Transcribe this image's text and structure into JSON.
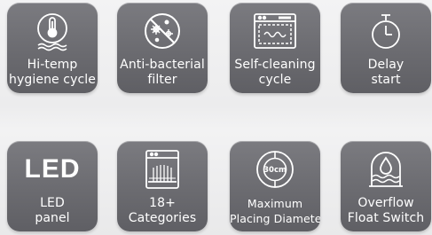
{
  "features": [
    {
      "id": "hitemp",
      "icon": "thermometer-hygiene-icon",
      "lines": [
        "Hi-temp",
        "hygiene cycle"
      ]
    },
    {
      "id": "antibac",
      "icon": "anti-bacterial-icon",
      "lines": [
        "Anti-bacterial",
        "filter"
      ]
    },
    {
      "id": "selfclean",
      "icon": "self-cleaning-oven-icon",
      "lines": [
        "Self-cleaning",
        "cycle"
      ]
    },
    {
      "id": "delay",
      "icon": "stopwatch-icon",
      "lines": [
        "Delay",
        "start"
      ]
    },
    {
      "id": "ledpanel",
      "icon": "led-icon",
      "icon_text": "LED",
      "lines": [
        "LED",
        "panel"
      ]
    },
    {
      "id": "categories",
      "icon": "dish-rack-icon",
      "lines": [
        "18+",
        "Categories"
      ]
    },
    {
      "id": "diameter",
      "icon": "diameter-30cm-icon",
      "icon_text": "30cm",
      "lines": [
        "Maximum",
        "Placing Diameter"
      ]
    },
    {
      "id": "overflow",
      "icon": "overflow-float-switch-icon",
      "lines": [
        "Overflow",
        "Float Switch"
      ]
    }
  ]
}
